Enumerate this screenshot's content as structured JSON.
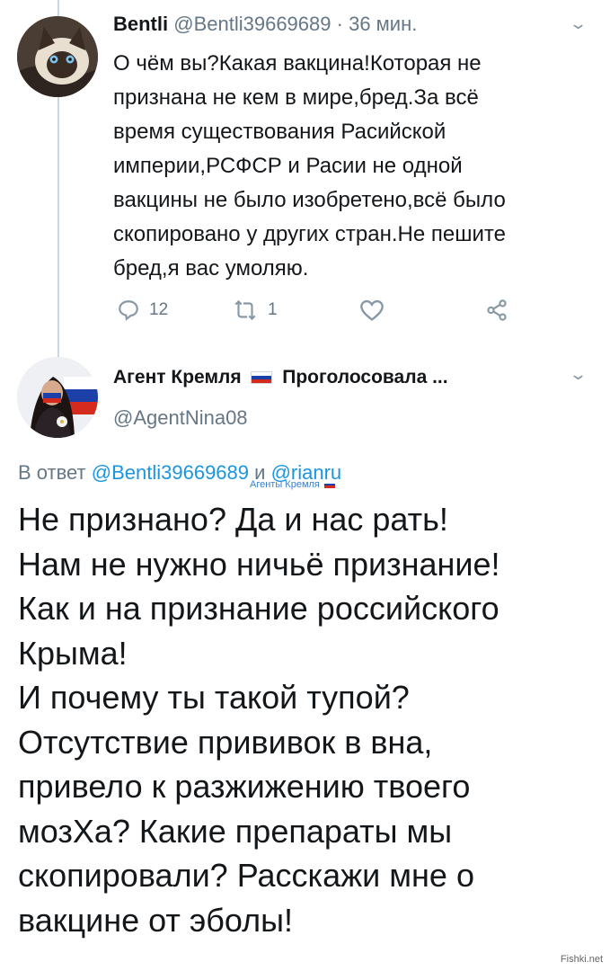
{
  "tweet1": {
    "display_name": "Bentli",
    "handle": "@Bentli39669689",
    "separator": "·",
    "time": "36 мин.",
    "lines": [
      "О чём вы?Какая вакцина!Которая не",
      "признана не кем в мире,бред.За всё",
      "время существования  Расийской",
      "империи,РСФСР и Расии не одной",
      "вакцины не было изобретено,всё было",
      "скопировано у других стран.Не пешите",
      "бред,я вас умоляю."
    ],
    "reply_count": "12",
    "retweet_count": "1"
  },
  "tweet2": {
    "display_name": "Агент Кремля",
    "display_name_rest": "Проголосовала ...",
    "handle": "@AgentNina08",
    "reply_prefix": "В ответ",
    "reply_to_1": "@Bentli39669689",
    "reply_and": "и",
    "reply_to_2": "@rianru",
    "stamp": "Агенты Кремля",
    "lines": [
      "Не признано? Да и нас рать!",
      "Нам не нужно ничьё признание!",
      "Как и на признание российского",
      "Крыма!",
      "И почему ты такой тупой?",
      "Отсутствие прививок в вна,",
      "привело к разжижению твоего",
      "мозХа? Какие препараты мы",
      "скопировали? Расскажи мне о",
      "вакцине от эболы!"
    ]
  },
  "watermark": "Fishki.net",
  "icons": [
    "reply-icon",
    "retweet-icon",
    "like-icon",
    "share-icon",
    "chevron-down-icon",
    "russian-flag-icon"
  ],
  "colors": {
    "link": "#1b95e0",
    "muted": "#657786",
    "icon": "#8899a6",
    "flag_white": "#ffffff",
    "flag_blue": "#1c3fa8",
    "flag_red": "#d52b1e"
  }
}
